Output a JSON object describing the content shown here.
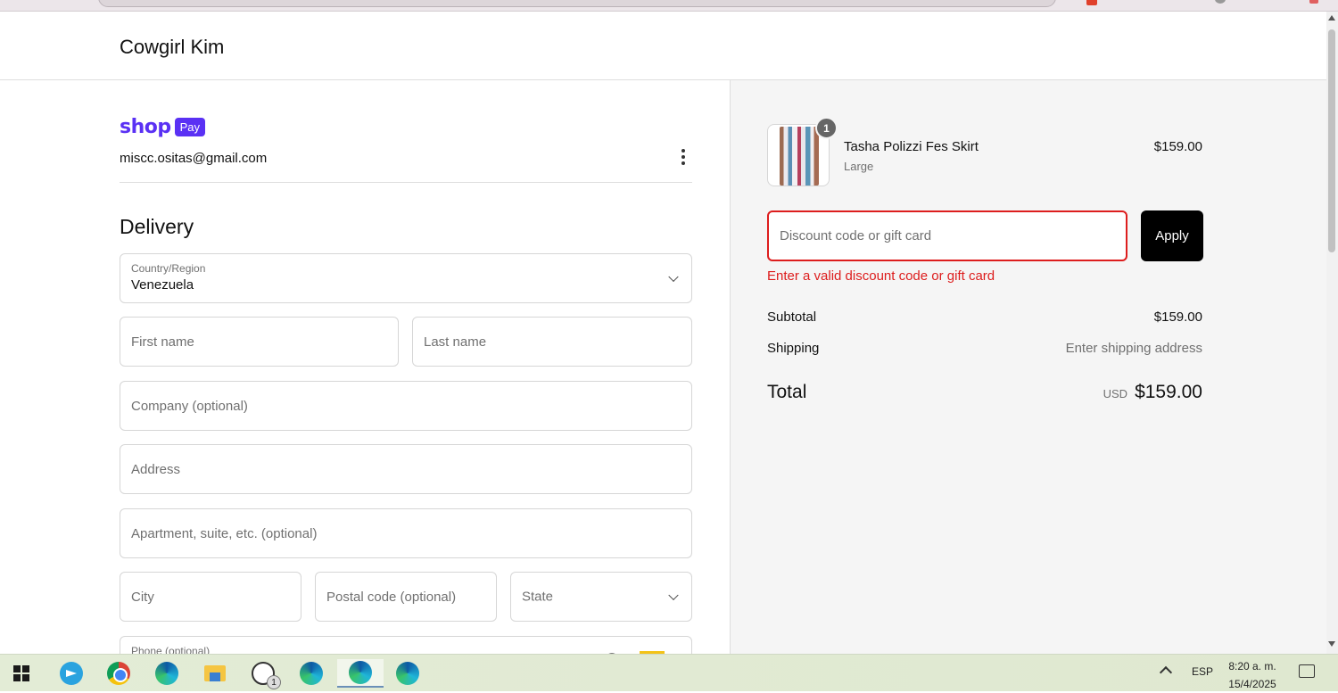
{
  "store": {
    "name": "Cowgirl Kim"
  },
  "shop_pay": {
    "shop": "shop",
    "pay": "Pay",
    "email": "miscc.ositas@gmail.com"
  },
  "delivery": {
    "title": "Delivery",
    "country_label": "Country/Region",
    "country_value": "Venezuela",
    "first_name_placeholder": "First name",
    "last_name_placeholder": "Last name",
    "company_placeholder": "Company (optional)",
    "address_placeholder": "Address",
    "apartment_placeholder": "Apartment, suite, etc. (optional)",
    "city_placeholder": "City",
    "postal_placeholder": "Postal code (optional)",
    "state_placeholder": "State",
    "phone_label": "Phone (optional)"
  },
  "summary": {
    "product": {
      "name": "Tasha Polizzi Fes Skirt",
      "variant": "Large",
      "price": "$159.00",
      "quantity": "1"
    },
    "discount_placeholder": "Discount code or gift card",
    "apply_label": "Apply",
    "error": "Enter a valid discount code or gift card",
    "subtotal_label": "Subtotal",
    "subtotal_value": "$159.00",
    "shipping_label": "Shipping",
    "shipping_value": "Enter shipping address",
    "total_label": "Total",
    "total_currency": "USD",
    "total_value": "$159.00"
  },
  "taskbar": {
    "icons": [
      "windows-start-icon",
      "telegram-icon",
      "chrome-icon",
      "edge-profile-icon",
      "file-explorer-icon",
      "whatsapp-icon",
      "edge-icon",
      "edge-icon",
      "edge-icon"
    ],
    "whatsapp_badge": "1",
    "language": "ESP",
    "time": "8:20 a. m.",
    "date": "15/4/2025"
  },
  "colors": {
    "accent_shoppay": "#5a31f4",
    "error": "#dd1d1d",
    "button": "#000000"
  }
}
